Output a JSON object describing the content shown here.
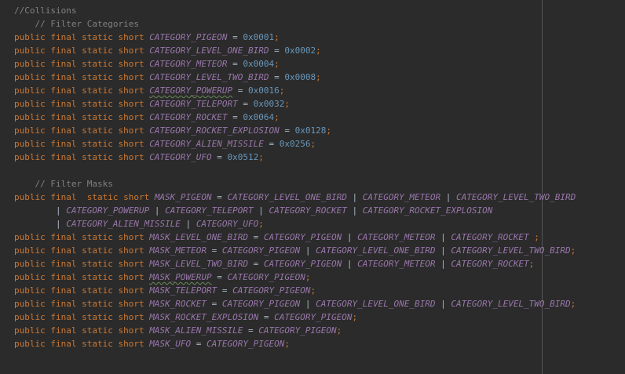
{
  "code": {
    "lines": [
      [
        {
          "t": "//Collisions",
          "c": "cm"
        }
      ],
      [
        {
          "t": "    // Filter Categories",
          "c": "cm"
        }
      ],
      [
        {
          "t": "public final static short ",
          "c": "kw"
        },
        {
          "t": "CATEGORY_PIGEON",
          "c": "const"
        },
        {
          "t": " = ",
          "c": "op"
        },
        {
          "t": "0x0001",
          "c": "num"
        },
        {
          "t": ";",
          "c": "kw"
        }
      ],
      [
        {
          "t": "public final static short ",
          "c": "kw"
        },
        {
          "t": "CATEGORY_LEVEL_ONE_BIRD",
          "c": "const"
        },
        {
          "t": " = ",
          "c": "op"
        },
        {
          "t": "0x0002",
          "c": "num"
        },
        {
          "t": ";",
          "c": "kw"
        }
      ],
      [
        {
          "t": "public final static short ",
          "c": "kw"
        },
        {
          "t": "CATEGORY_METEOR",
          "c": "const"
        },
        {
          "t": " = ",
          "c": "op"
        },
        {
          "t": "0x0004",
          "c": "num"
        },
        {
          "t": ";",
          "c": "kw"
        }
      ],
      [
        {
          "t": "public final static short ",
          "c": "kw"
        },
        {
          "t": "CATEGORY_LEVEL_TWO_BIRD",
          "c": "const"
        },
        {
          "t": " = ",
          "c": "op"
        },
        {
          "t": "0x0008",
          "c": "num"
        },
        {
          "t": ";",
          "c": "kw"
        }
      ],
      [
        {
          "t": "public final static short ",
          "c": "kw"
        },
        {
          "t": "CATEGORY_POWERUP",
          "c": "const",
          "w": true
        },
        {
          "t": " = ",
          "c": "op"
        },
        {
          "t": "0x0016",
          "c": "num"
        },
        {
          "t": ";",
          "c": "kw"
        }
      ],
      [
        {
          "t": "public final static short ",
          "c": "kw"
        },
        {
          "t": "CATEGORY_TELEPORT",
          "c": "const"
        },
        {
          "t": " = ",
          "c": "op"
        },
        {
          "t": "0x0032",
          "c": "num"
        },
        {
          "t": ";",
          "c": "kw"
        }
      ],
      [
        {
          "t": "public final static short ",
          "c": "kw"
        },
        {
          "t": "CATEGORY_ROCKET",
          "c": "const"
        },
        {
          "t": " = ",
          "c": "op"
        },
        {
          "t": "0x0064",
          "c": "num"
        },
        {
          "t": ";",
          "c": "kw"
        }
      ],
      [
        {
          "t": "public final static short ",
          "c": "kw"
        },
        {
          "t": "CATEGORY_ROCKET_EXPLOSION",
          "c": "const"
        },
        {
          "t": " = ",
          "c": "op"
        },
        {
          "t": "0x0128",
          "c": "num"
        },
        {
          "t": ";",
          "c": "kw"
        }
      ],
      [
        {
          "t": "public final static short ",
          "c": "kw"
        },
        {
          "t": "CATEGORY_ALIEN_MISSILE",
          "c": "const"
        },
        {
          "t": " = ",
          "c": "op"
        },
        {
          "t": "0x0256",
          "c": "num"
        },
        {
          "t": ";",
          "c": "kw"
        }
      ],
      [
        {
          "t": "public final static short ",
          "c": "kw"
        },
        {
          "t": "CATEGORY_UFO",
          "c": "const"
        },
        {
          "t": " = ",
          "c": "op"
        },
        {
          "t": "0x0512",
          "c": "num"
        },
        {
          "t": ";",
          "c": "kw"
        }
      ],
      [],
      [
        {
          "t": "    // Filter Masks",
          "c": "cm"
        }
      ],
      [
        {
          "t": "public final  static short ",
          "c": "kw"
        },
        {
          "t": "MASK_PIGEON",
          "c": "const"
        },
        {
          "t": " = ",
          "c": "op"
        },
        {
          "t": "CATEGORY_LEVEL_ONE_BIRD",
          "c": "const"
        },
        {
          "t": " | ",
          "c": "op"
        },
        {
          "t": "CATEGORY_METEOR",
          "c": "const"
        },
        {
          "t": " | ",
          "c": "op"
        },
        {
          "t": "CATEGORY_LEVEL_TWO_BIRD",
          "c": "const"
        }
      ],
      [
        {
          "t": "        | ",
          "c": "op"
        },
        {
          "t": "CATEGORY_POWERUP",
          "c": "const"
        },
        {
          "t": " | ",
          "c": "op"
        },
        {
          "t": "CATEGORY_TELEPORT",
          "c": "const"
        },
        {
          "t": " | ",
          "c": "op"
        },
        {
          "t": "CATEGORY_ROCKET",
          "c": "const"
        },
        {
          "t": " | ",
          "c": "op"
        },
        {
          "t": "CATEGORY_ROCKET_EXPLOSION",
          "c": "const"
        }
      ],
      [
        {
          "t": "        | ",
          "c": "op"
        },
        {
          "t": "CATEGORY_ALIEN_MISSILE",
          "c": "const"
        },
        {
          "t": " | ",
          "c": "op"
        },
        {
          "t": "CATEGORY_UFO",
          "c": "const"
        },
        {
          "t": ";",
          "c": "kw"
        }
      ],
      [
        {
          "t": "public final static short ",
          "c": "kw"
        },
        {
          "t": "MASK_LEVEL_ONE_BIRD",
          "c": "const"
        },
        {
          "t": " = ",
          "c": "op"
        },
        {
          "t": "CATEGORY_PIGEON",
          "c": "const"
        },
        {
          "t": " | ",
          "c": "op"
        },
        {
          "t": "CATEGORY_METEOR",
          "c": "const"
        },
        {
          "t": " | ",
          "c": "op"
        },
        {
          "t": "CATEGORY_ROCKET",
          "c": "const"
        },
        {
          "t": " ;",
          "c": "kw"
        }
      ],
      [
        {
          "t": "public final static short ",
          "c": "kw"
        },
        {
          "t": "MASK_METEOR",
          "c": "const"
        },
        {
          "t": " = ",
          "c": "op"
        },
        {
          "t": "CATEGORY_PIGEON",
          "c": "const"
        },
        {
          "t": " | ",
          "c": "op"
        },
        {
          "t": "CATEGORY_LEVEL_ONE_BIRD",
          "c": "const"
        },
        {
          "t": " | ",
          "c": "op"
        },
        {
          "t": "CATEGORY_LEVEL_TWO_BIRD",
          "c": "const"
        },
        {
          "t": ";",
          "c": "kw"
        }
      ],
      [
        {
          "t": "public final static short ",
          "c": "kw"
        },
        {
          "t": "MASK_LEVEL_TWO_BIRD",
          "c": "const"
        },
        {
          "t": " = ",
          "c": "op"
        },
        {
          "t": "CATEGORY_PIGEON",
          "c": "const"
        },
        {
          "t": " | ",
          "c": "op"
        },
        {
          "t": "CATEGORY_METEOR",
          "c": "const"
        },
        {
          "t": " | ",
          "c": "op"
        },
        {
          "t": "CATEGORY_ROCKET",
          "c": "const"
        },
        {
          "t": ";",
          "c": "kw"
        }
      ],
      [
        {
          "t": "public final static short ",
          "c": "kw"
        },
        {
          "t": "MASK_POWERUP",
          "c": "const",
          "w": true
        },
        {
          "t": " = ",
          "c": "op"
        },
        {
          "t": "CATEGORY_PIGEON",
          "c": "const"
        },
        {
          "t": ";",
          "c": "kw"
        }
      ],
      [
        {
          "t": "public final static short ",
          "c": "kw"
        },
        {
          "t": "MASK_TELEPORT",
          "c": "const"
        },
        {
          "t": " = ",
          "c": "op"
        },
        {
          "t": "CATEGORY_PIGEON",
          "c": "const"
        },
        {
          "t": ";",
          "c": "kw"
        }
      ],
      [
        {
          "t": "public final static short ",
          "c": "kw"
        },
        {
          "t": "MASK_ROCKET",
          "c": "const"
        },
        {
          "t": " = ",
          "c": "op"
        },
        {
          "t": "CATEGORY_PIGEON",
          "c": "const"
        },
        {
          "t": " | ",
          "c": "op"
        },
        {
          "t": "CATEGORY_LEVEL_ONE_BIRD",
          "c": "const"
        },
        {
          "t": " | ",
          "c": "op"
        },
        {
          "t": "CATEGORY_LEVEL_TWO_BIRD",
          "c": "const"
        },
        {
          "t": ";",
          "c": "kw"
        }
      ],
      [
        {
          "t": "public final static short ",
          "c": "kw"
        },
        {
          "t": "MASK_ROCKET_EXPLOSION",
          "c": "const"
        },
        {
          "t": " = ",
          "c": "op"
        },
        {
          "t": "CATEGORY_PIGEON",
          "c": "const"
        },
        {
          "t": ";",
          "c": "kw"
        }
      ],
      [
        {
          "t": "public final static short ",
          "c": "kw"
        },
        {
          "t": "MASK_ALIEN_MISSILE",
          "c": "const"
        },
        {
          "t": " = ",
          "c": "op"
        },
        {
          "t": "CATEGORY_PIGEON",
          "c": "const"
        },
        {
          "t": ";",
          "c": "kw"
        }
      ],
      [
        {
          "t": "public final static short ",
          "c": "kw"
        },
        {
          "t": "MASK_UFO",
          "c": "const"
        },
        {
          "t": " = ",
          "c": "op"
        },
        {
          "t": "CATEGORY_PIGEON",
          "c": "const"
        },
        {
          "t": ";",
          "c": "kw"
        }
      ]
    ]
  },
  "colors": {
    "background": "#2b2b2b",
    "keyword": "#cc7832",
    "constant": "#9876aa",
    "number": "#6897bb",
    "comment": "#808080",
    "text": "#a9b7c6"
  }
}
